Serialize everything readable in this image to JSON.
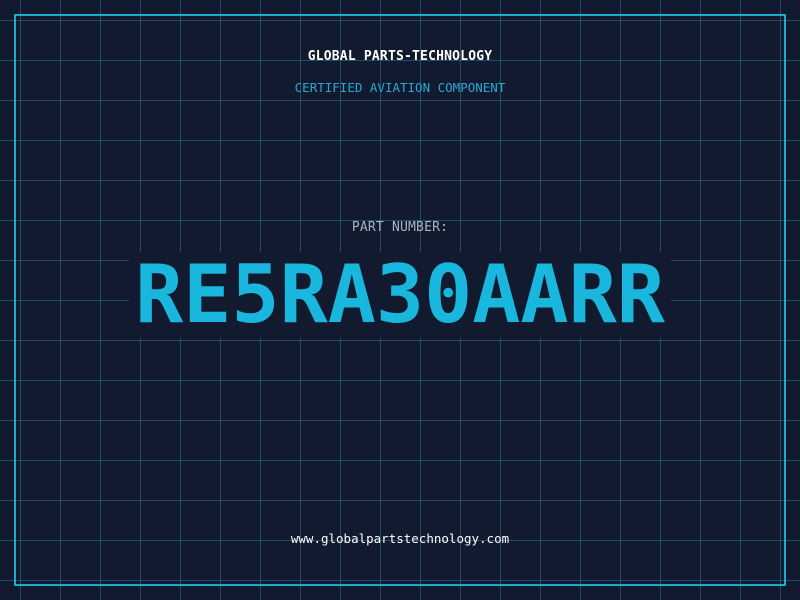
{
  "header": {
    "company": "GLOBAL PARTS-TECHNOLOGY",
    "subtitle": "CERTIFIED AVIATION COMPONENT"
  },
  "part": {
    "label": "PART NUMBER:",
    "number": "RE5RA30AARR"
  },
  "footer": {
    "website": "www.globalpartstechnology.com"
  },
  "colors": {
    "background": "#111a2e",
    "grid": "#28789a",
    "accent": "#19b6dd",
    "frame": "#1fa9cf",
    "text": "#ffffff",
    "muted": "#aab4c0"
  }
}
